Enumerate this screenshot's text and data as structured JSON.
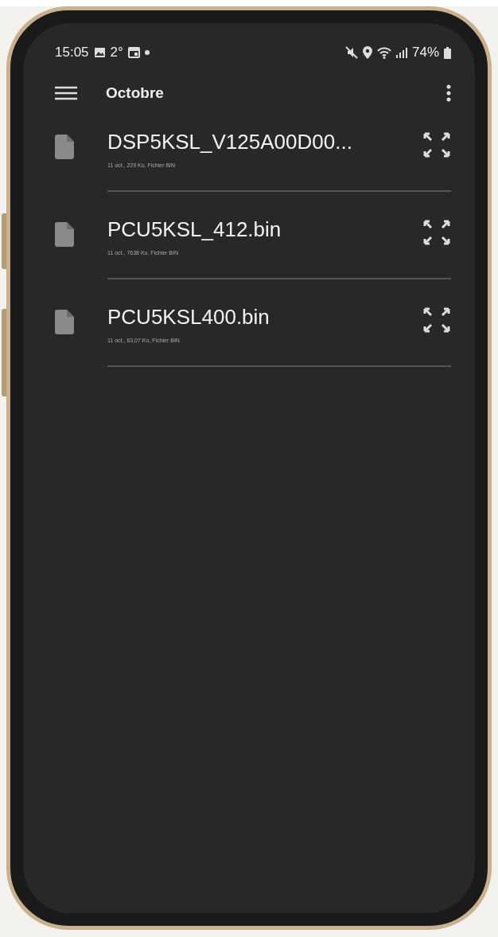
{
  "status_bar": {
    "time": "15:05",
    "temperature": "2°",
    "battery": "74%"
  },
  "app_bar": {
    "title": "Octobre"
  },
  "files": [
    {
      "name": "DSP5KSL_V125A00D00...",
      "details": "11 oct., 229 Ko, Fichier BIN"
    },
    {
      "name": "PCU5KSL_412.bin",
      "details": "11 oct., 7638 Ko, Fichier BIN"
    },
    {
      "name": "PCU5KSL400.bin",
      "details": "11 oct., 63,07 Ko, Fichier BIN"
    }
  ]
}
